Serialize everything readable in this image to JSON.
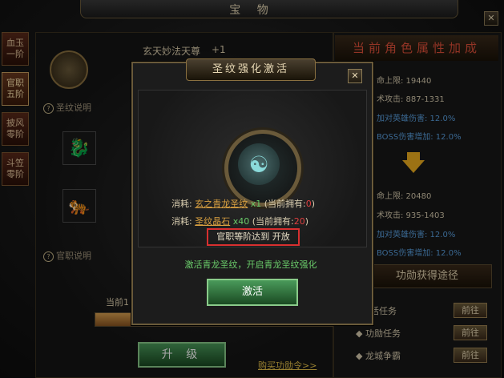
{
  "window": {
    "title": "宝 物",
    "close_symbol": "✕"
  },
  "left_tabs": [
    {
      "label": "血玉一阶",
      "active": false
    },
    {
      "label": "官职五阶",
      "active": true
    },
    {
      "label": "披风零阶",
      "active": false
    },
    {
      "label": "斗笠零阶",
      "active": false
    }
  ],
  "item": {
    "name": "玄天妙法天尊",
    "level": "+1"
  },
  "section_labels": {
    "rune_info": "圣纹说明",
    "rank_info": "官职说明",
    "help_symbol": "?"
  },
  "progress": {
    "label": "当前1",
    "fraction": 0.35
  },
  "upgrade_button": "升 级",
  "buy_link": "购买功勋令>>",
  "attributes": {
    "header": "当前角色属性加成",
    "current": [
      {
        "text": "命上限: 19440",
        "highlight": false
      },
      {
        "text": "术攻击: 887-1331",
        "highlight": false
      },
      {
        "text": "加对英雄伤害: 12.0%",
        "highlight": true
      },
      {
        "text": "BOSS伤害增加: 12.0%",
        "highlight": true
      }
    ],
    "next": [
      {
        "text": "命上限: 20480",
        "highlight": false
      },
      {
        "text": "术攻击: 935-1403",
        "highlight": false
      },
      {
        "text": "加对英雄伤害: 12.0%",
        "highlight": true
      },
      {
        "text": "BOSS伤害增加: 12.0%",
        "highlight": true
      }
    ]
  },
  "merit_ways": {
    "header": "功勋获得途径",
    "items": [
      {
        "label": "活任务",
        "button": "前往"
      },
      {
        "label": "功勋任务",
        "button": "前往"
      },
      {
        "label": "龙城争霸",
        "button": "前往"
      }
    ]
  },
  "dialog": {
    "title": "圣纹强化激活",
    "close_symbol": "✕",
    "seal_symbol": "☯",
    "cost1": {
      "prefix": "消耗:",
      "item": "玄之青龙圣纹",
      "count": "x1",
      "own_prefix": "(当前拥有:",
      "own": "0",
      "own_suffix": ")"
    },
    "cost2": {
      "prefix": "消耗:",
      "item": "圣纹晶石",
      "count": "x40",
      "own_prefix": "(当前拥有:",
      "own": "20",
      "own_suffix": ")"
    },
    "requirement": "官职等阶达到 开放",
    "description": "激活青龙圣纹，开启青龙圣纹强化",
    "activate_button": "激活"
  },
  "colors": {
    "accent_gold": "#e6c24a",
    "success_green": "#6acb6a",
    "warn_red": "#d83030",
    "stat_blue": "#5aa0e0"
  }
}
